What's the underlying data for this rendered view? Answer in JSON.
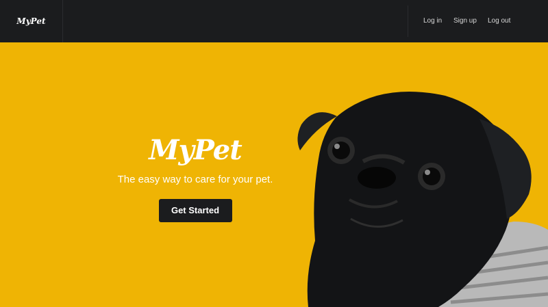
{
  "nav": {
    "brand": "MyPet",
    "links": [
      {
        "label": "Log in"
      },
      {
        "label": "Sign up"
      },
      {
        "label": "Log out"
      }
    ]
  },
  "hero": {
    "title": "MyPet",
    "subtitle": "The easy way to care for your pet.",
    "cta_label": "Get Started",
    "background_color": "#efb404",
    "image": "pug-in-sweater-photo"
  },
  "colors": {
    "navbar": "#1b1c1e",
    "button": "#1b1c1e",
    "text_light": "#ffffff"
  }
}
